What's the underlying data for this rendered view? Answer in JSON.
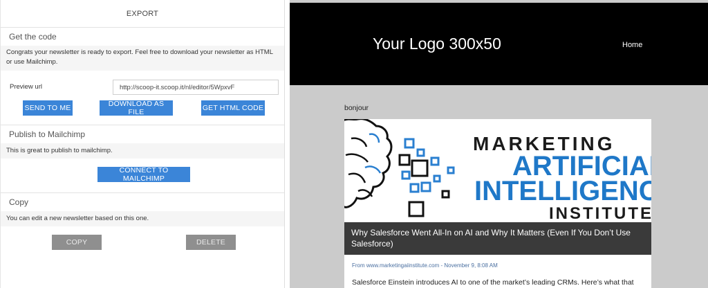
{
  "export_panel": {
    "title": "EXPORT",
    "get_code": {
      "heading": "Get the code",
      "description": "Congrats your newsletter is ready to export. Feel free to download your newsletter as HTML or use Mailchimp.",
      "preview_label": "Preview url",
      "preview_url": "http://scoop-it.scoop.it/nl/editor/5WpxvF",
      "send_label": "SEND TO ME",
      "download_label": "DOWNLOAD AS FILE",
      "html_label": "GET HTML CODE"
    },
    "mailchimp": {
      "heading": "Publish to Mailchimp",
      "description": "This is great to publish to mailchimp.",
      "connect_label": "CONNECT TO MAILCHIMP"
    },
    "copy": {
      "heading": "Copy",
      "description": "You can edit a new newsletter based on this one.",
      "copy_label": "COPY",
      "delete_label": "DELETE"
    }
  },
  "preview": {
    "logo_text": "Your Logo 300x50",
    "nav_home": "Home",
    "greeting": "bonjour",
    "article": {
      "image_lines": [
        "MARKETING",
        "ARTIFICIAL",
        "INTELLIGENCE",
        "INSTITUTE"
      ],
      "headline": "Why Salesforce Went All-In on AI and Why It Matters (Even If You Don’t Use Salesforce)",
      "source": "From www.marketingaiinstitute.com - November 9, 8:08 AM",
      "excerpt": "Salesforce Einstein introduces AI to one of the market’s leading CRMs. Here’s what that"
    }
  },
  "colors": {
    "primary_button": "#3b85d8",
    "disabled_button": "#8f8f8f",
    "logo_blue": "#1f78c8",
    "banner": "#000000",
    "preview_bg": "#cbcbcb"
  },
  "icons": {
    "article_image": "brain-icon"
  }
}
